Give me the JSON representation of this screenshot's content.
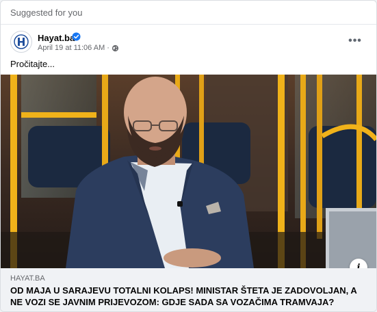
{
  "feed": {
    "section_label": "Suggested for you"
  },
  "post": {
    "page_name": "Hayat.ba",
    "timestamp": "April 19 at 11:06 AM",
    "separator": "·",
    "text": "Pročitajte...",
    "avatar_letter": "H",
    "privacy_icon": "globe-icon",
    "verified_icon": "verified-badge-icon",
    "more_icon": "more-options-icon",
    "more_label": "•••"
  },
  "link": {
    "domain": "HAYAT.BA",
    "title": "OD MAJA U SARAJEVU TOTALNI KOLAPS! MINISTAR ŠTETA JE ZADOVOLJAN, A NE VOZI SE JAVNIM PRIJEVOZOM: GDJE SADA SA VOZAČIMA TRAMVAJA?",
    "info_label": "i",
    "info_icon": "info-icon"
  },
  "colors": {
    "accent": "#1877f2",
    "brand": "#1f4e9c",
    "secondary_text": "#65676b"
  }
}
